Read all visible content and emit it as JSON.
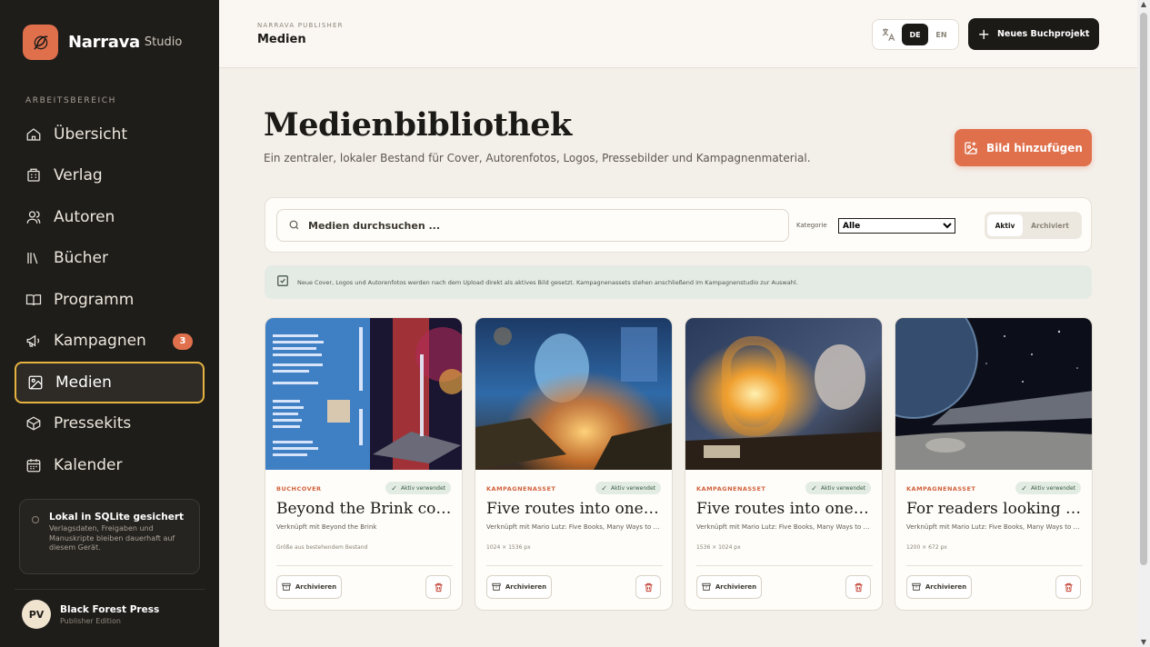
{
  "app": {
    "brand": "Narrava",
    "brand_sub": "Studio"
  },
  "sidebar": {
    "section_label": "ARBEITSBEREICH",
    "items": [
      {
        "label": "Übersicht",
        "icon": "home-icon"
      },
      {
        "label": "Verlag",
        "icon": "building-icon"
      },
      {
        "label": "Autoren",
        "icon": "users-icon"
      },
      {
        "label": "Bücher",
        "icon": "library-icon"
      },
      {
        "label": "Programm",
        "icon": "book-open-icon"
      },
      {
        "label": "Kampagnen",
        "icon": "megaphone-icon",
        "badge": "3"
      },
      {
        "label": "Medien",
        "icon": "image-icon",
        "active": true
      },
      {
        "label": "Pressekits",
        "icon": "package-icon"
      },
      {
        "label": "Kalender",
        "icon": "calendar-icon"
      }
    ],
    "storage": {
      "title": "Lokal in SQLite gesichert",
      "text": "Verlagsdaten, Freigaben und Manuskripte bleiben dauerhaft auf diesem Gerät."
    },
    "user": {
      "initials": "PV",
      "name": "Black Forest Press",
      "edition": "Publisher Edition"
    }
  },
  "topbar": {
    "crumb_small": "NARRAVA PUBLISHER",
    "crumb_title": "Medien",
    "lang_de": "DE",
    "lang_en": "EN",
    "new_project": "Neues Buchprojekt"
  },
  "main": {
    "title": "Medienbibliothek",
    "subtitle": "Ein zentraler, lokaler Bestand für Cover, Autorenfotos, Logos, Pressebilder und Kampagnenmaterial.",
    "add_image": "Bild hinzufügen",
    "search_placeholder": "Medien durchsuchen ...",
    "category_label": "Kategorie",
    "category_value": "Alle",
    "tab_active": "Aktiv",
    "tab_archived": "Archiviert",
    "notice": "Neue Cover, Logos und Autorenfotos werden nach dem Upload direkt als aktives Bild gesetzt. Kampagnenassets stehen anschließend im Kampagnenstudio zur Auswahl."
  },
  "cards": [
    {
      "category": "BUCHCOVER",
      "status": "Aktiv verwendet",
      "title": "Beyond the Brink cover",
      "link": "Verknüpft mit Beyond the Brink",
      "size": "Größe aus bestehendem Bestand",
      "archive": "Archivieren"
    },
    {
      "category": "KAMPAGNENASSET",
      "status": "Aktiv verwendet",
      "title": "Five routes into one catalog",
      "link": "Verknüpft mit Mario Lutz: Five Books, Many Ways to Begin",
      "size": "1024 × 1536 px",
      "archive": "Archivieren"
    },
    {
      "category": "KAMPAGNENASSET",
      "status": "Aktiv verwendet",
      "title": "Five routes into one catalog",
      "link": "Verknüpft mit Mario Lutz: Five Books, Many Ways to Begin",
      "size": "1536 × 1024 px",
      "archive": "Archivieren"
    },
    {
      "category": "KAMPAGNENASSET",
      "status": "Aktiv verwendet",
      "title": "For readers looking to travel",
      "link": "Verknüpft mit Mario Lutz: Five Books, Many Ways to Begin",
      "size": "1200 × 672 px",
      "archive": "Archivieren"
    }
  ],
  "colors": {
    "accent": "#e0704c",
    "sidebar": "#1f1d1a",
    "active_border": "#e6b340",
    "background": "#f3efe9"
  }
}
